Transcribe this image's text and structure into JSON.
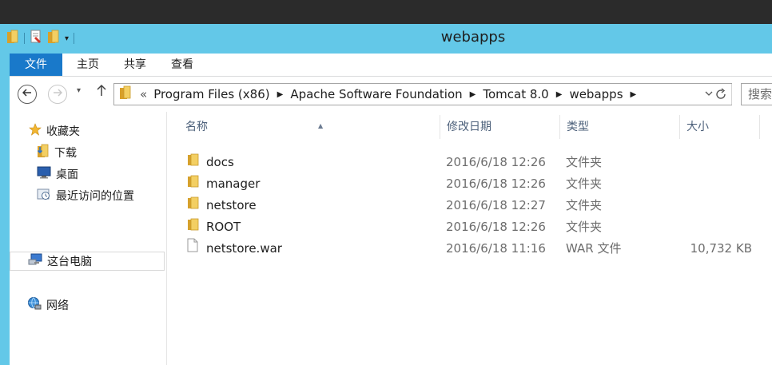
{
  "window": {
    "title": "webapps"
  },
  "ribbon": {
    "tabs": [
      "文件",
      "主页",
      "共享",
      "查看"
    ]
  },
  "address": {
    "overflow": "«",
    "crumbs": [
      "Program Files (x86)",
      "Apache Software Foundation",
      "Tomcat 8.0",
      "webapps"
    ]
  },
  "search": {
    "placeholder": "搜索"
  },
  "sidebar": {
    "favorites": "收藏夹",
    "downloads": "下载",
    "desktop": "桌面",
    "recent": "最近访问的位置",
    "thispc": "这台电脑",
    "network": "网络"
  },
  "columns": {
    "name": "名称",
    "date": "修改日期",
    "type": "类型",
    "size": "大小"
  },
  "files": [
    {
      "name": "docs",
      "date": "2016/6/18 12:26",
      "type": "文件夹",
      "size": "",
      "kind": "folder"
    },
    {
      "name": "manager",
      "date": "2016/6/18 12:26",
      "type": "文件夹",
      "size": "",
      "kind": "folder"
    },
    {
      "name": "netstore",
      "date": "2016/6/18 12:27",
      "type": "文件夹",
      "size": "",
      "kind": "folder"
    },
    {
      "name": "ROOT",
      "date": "2016/6/18 12:26",
      "type": "文件夹",
      "size": "",
      "kind": "folder"
    },
    {
      "name": "netstore.war",
      "date": "2016/6/18 11:16",
      "type": "WAR 文件",
      "size": "10,732 KB",
      "kind": "file"
    }
  ],
  "colors": {
    "titlebar": "#63c8e8",
    "file_tab": "#1979ca",
    "header_text": "#4c607a",
    "folder": "#f0c24a"
  }
}
